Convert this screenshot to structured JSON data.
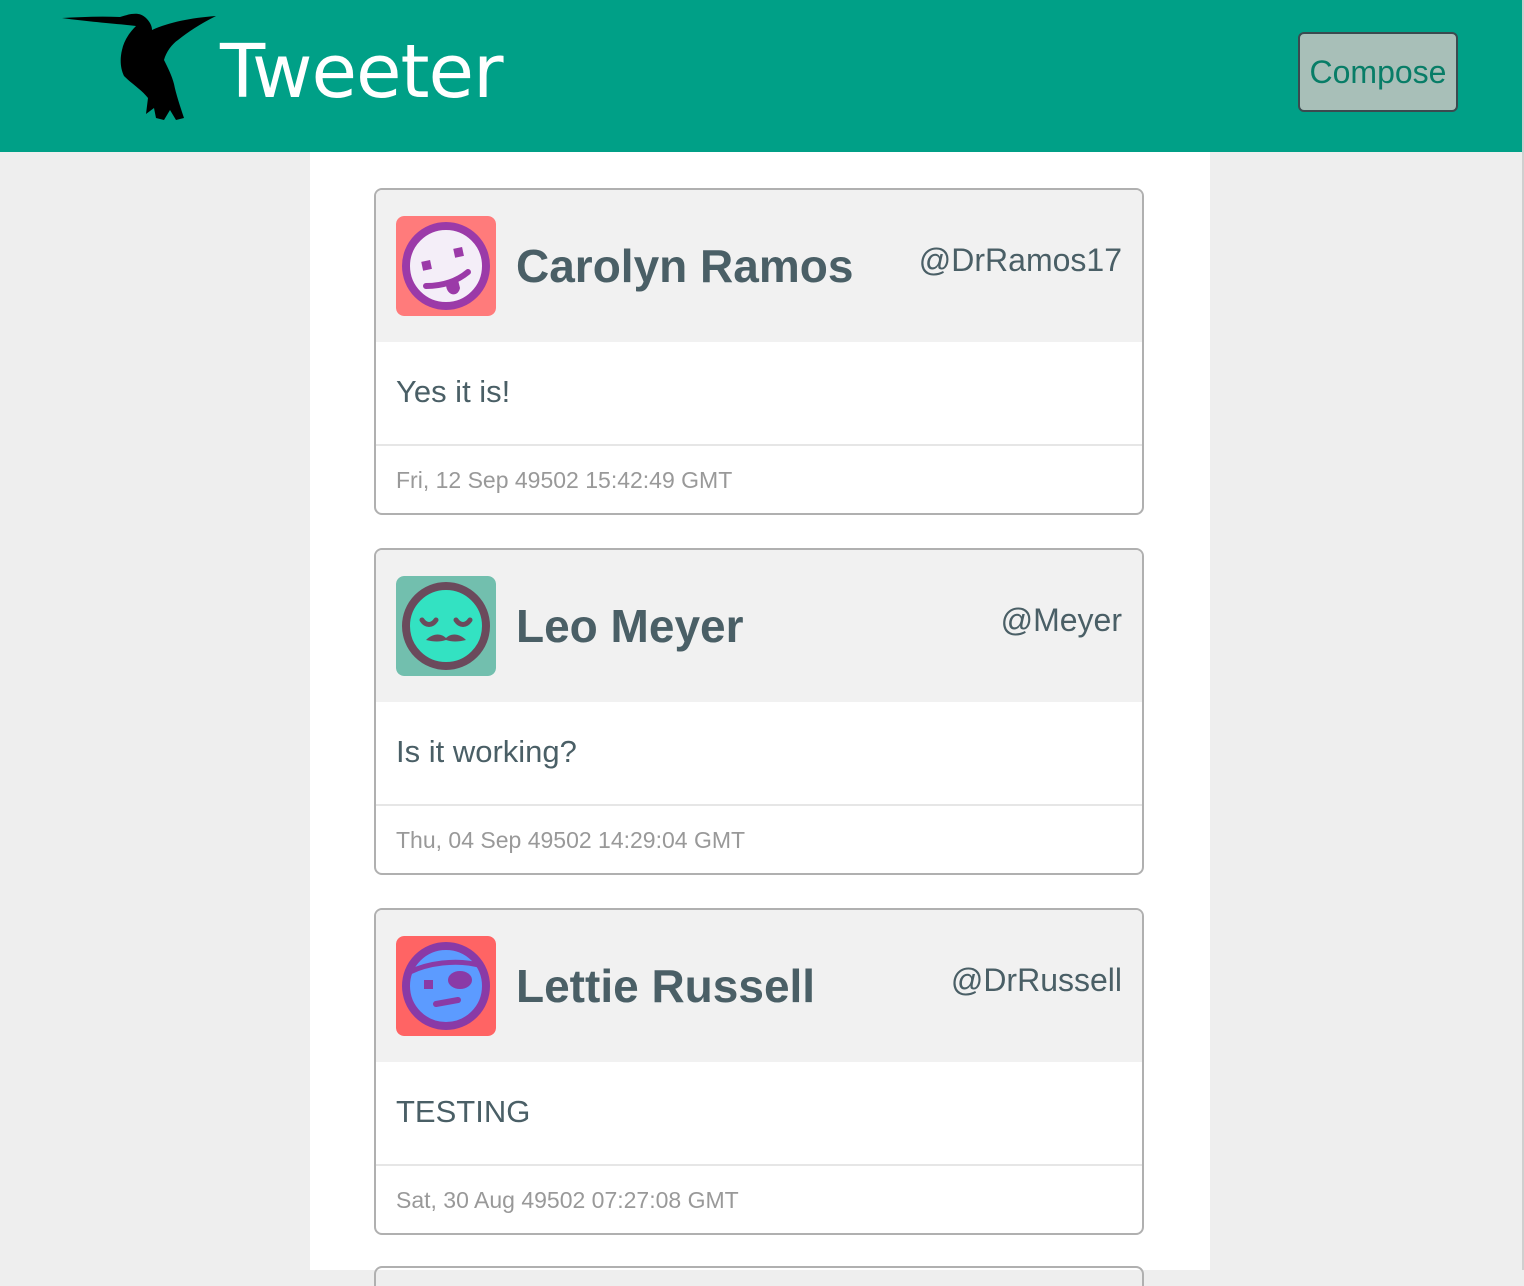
{
  "navbar": {
    "brand": "Tweeter",
    "logo_icon": "hummingbird-icon",
    "compose_label": "Compose",
    "background_color": "#00a087"
  },
  "tweets": [
    {
      "name": "Carolyn Ramos",
      "handle": "@DrRamos17",
      "text": "Yes it is!",
      "timestamp": "Fri, 12 Sep 49502 15:42:49 GMT",
      "avatar_icon": "tongue-out-face-avatar-icon",
      "avatar_bg": "#ff7b7b",
      "avatar_face": "#f4eef8",
      "avatar_ring": "#9b3aa8"
    },
    {
      "name": "Leo Meyer",
      "handle": "@Meyer",
      "text": "Is it working?",
      "timestamp": "Thu, 04 Sep 49502 14:29:04 GMT",
      "avatar_icon": "mustache-face-avatar-icon",
      "avatar_bg": "#72bfae",
      "avatar_face": "#33e2c2",
      "avatar_ring": "#6b4a5c"
    },
    {
      "name": "Lettie Russell",
      "handle": "@DrRussell",
      "text": "TESTING",
      "timestamp": "Sat, 30 Aug 49502 07:27:08 GMT",
      "avatar_icon": "pirate-face-avatar-icon",
      "avatar_bg": "#ff6464",
      "avatar_face": "#5c9bff",
      "avatar_ring": "#8a3aa6"
    }
  ]
}
